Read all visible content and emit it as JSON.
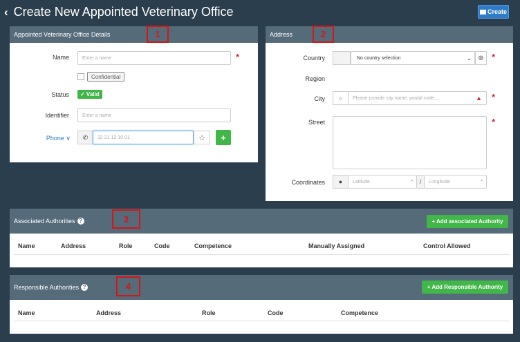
{
  "page": {
    "back_icon": "‹",
    "title": "Create New Appointed Veterinary Office",
    "create_label": "Create"
  },
  "details": {
    "header": "Appointed Veterinary Office Details",
    "marker": "1",
    "name_label": "Name",
    "name_placeholder": "Enter a name",
    "confidential_label": "Confidential",
    "status_label": "Status",
    "status_value": "✓ Valid",
    "identifier_label": "Identifier",
    "identifier_placeholder": "Enter a name",
    "phone_label": "Phone ∨",
    "phone_placeholder": "32 21 12 10 01",
    "add_label": "+"
  },
  "address": {
    "header": "Address",
    "marker": "2",
    "country_label": "Country",
    "country_value": "No country selection",
    "region_label": "Region",
    "city_label": "City",
    "city_placeholder": "Please provide city name, postal code...",
    "street_label": "Street",
    "coordinates_label": "Coordinates",
    "lat_placeholder": "Latitude",
    "lon_placeholder": "Longitude",
    "deg": "°",
    "slash": "/"
  },
  "associated": {
    "header": "Associated Authorities",
    "marker": "3",
    "add_label": "+ Add associated Authority",
    "columns": [
      "Name",
      "Address",
      "Role",
      "Code",
      "Competence",
      "Manually Assigned",
      "Control Allowed"
    ]
  },
  "responsible": {
    "header": "Responsible Authorities",
    "marker": "4",
    "add_label": "+ Add Responsible Authority",
    "columns": [
      "Name",
      "Address",
      "Role",
      "Code",
      "Competence"
    ]
  },
  "colors": {
    "background": "#2b3e4d",
    "panel_header": "#556b7a",
    "accent_blue": "#2f7bc8",
    "green": "#41b649",
    "required": "#c9302c",
    "marker_red": "#d31616"
  }
}
